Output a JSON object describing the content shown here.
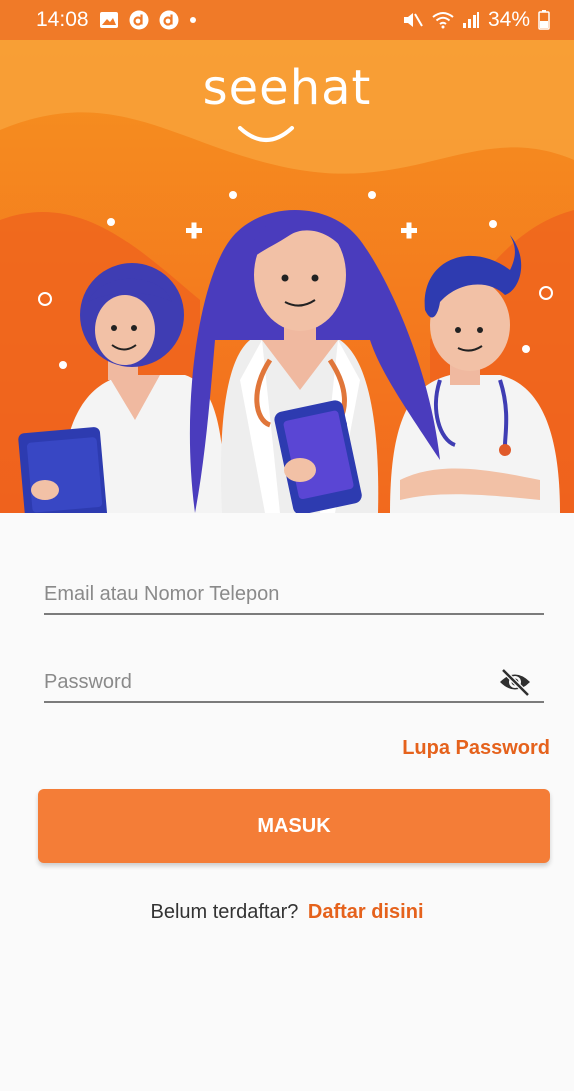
{
  "status_bar": {
    "time": "14:08",
    "battery": "34%",
    "left_icons": [
      "gallery-icon",
      "d-app-icon",
      "d-app-icon",
      "notification-dot-icon"
    ],
    "right_icons": [
      "mute-icon",
      "wifi-icon",
      "signal-icon",
      "battery-icon"
    ]
  },
  "hero": {
    "logo": "seehat"
  },
  "login": {
    "email_placeholder": "Email atau Nomor Telepon",
    "email_value": "",
    "password_placeholder": "Password",
    "password_value": "",
    "forgot_label": "Lupa Password",
    "submit_label": "MASUK",
    "signup_prompt": "Belum terdaftar?",
    "signup_link": "Daftar disini"
  },
  "colors": {
    "brand": "#f47d37",
    "accent_text": "#e5621c",
    "status_bar": "#f07a28"
  }
}
